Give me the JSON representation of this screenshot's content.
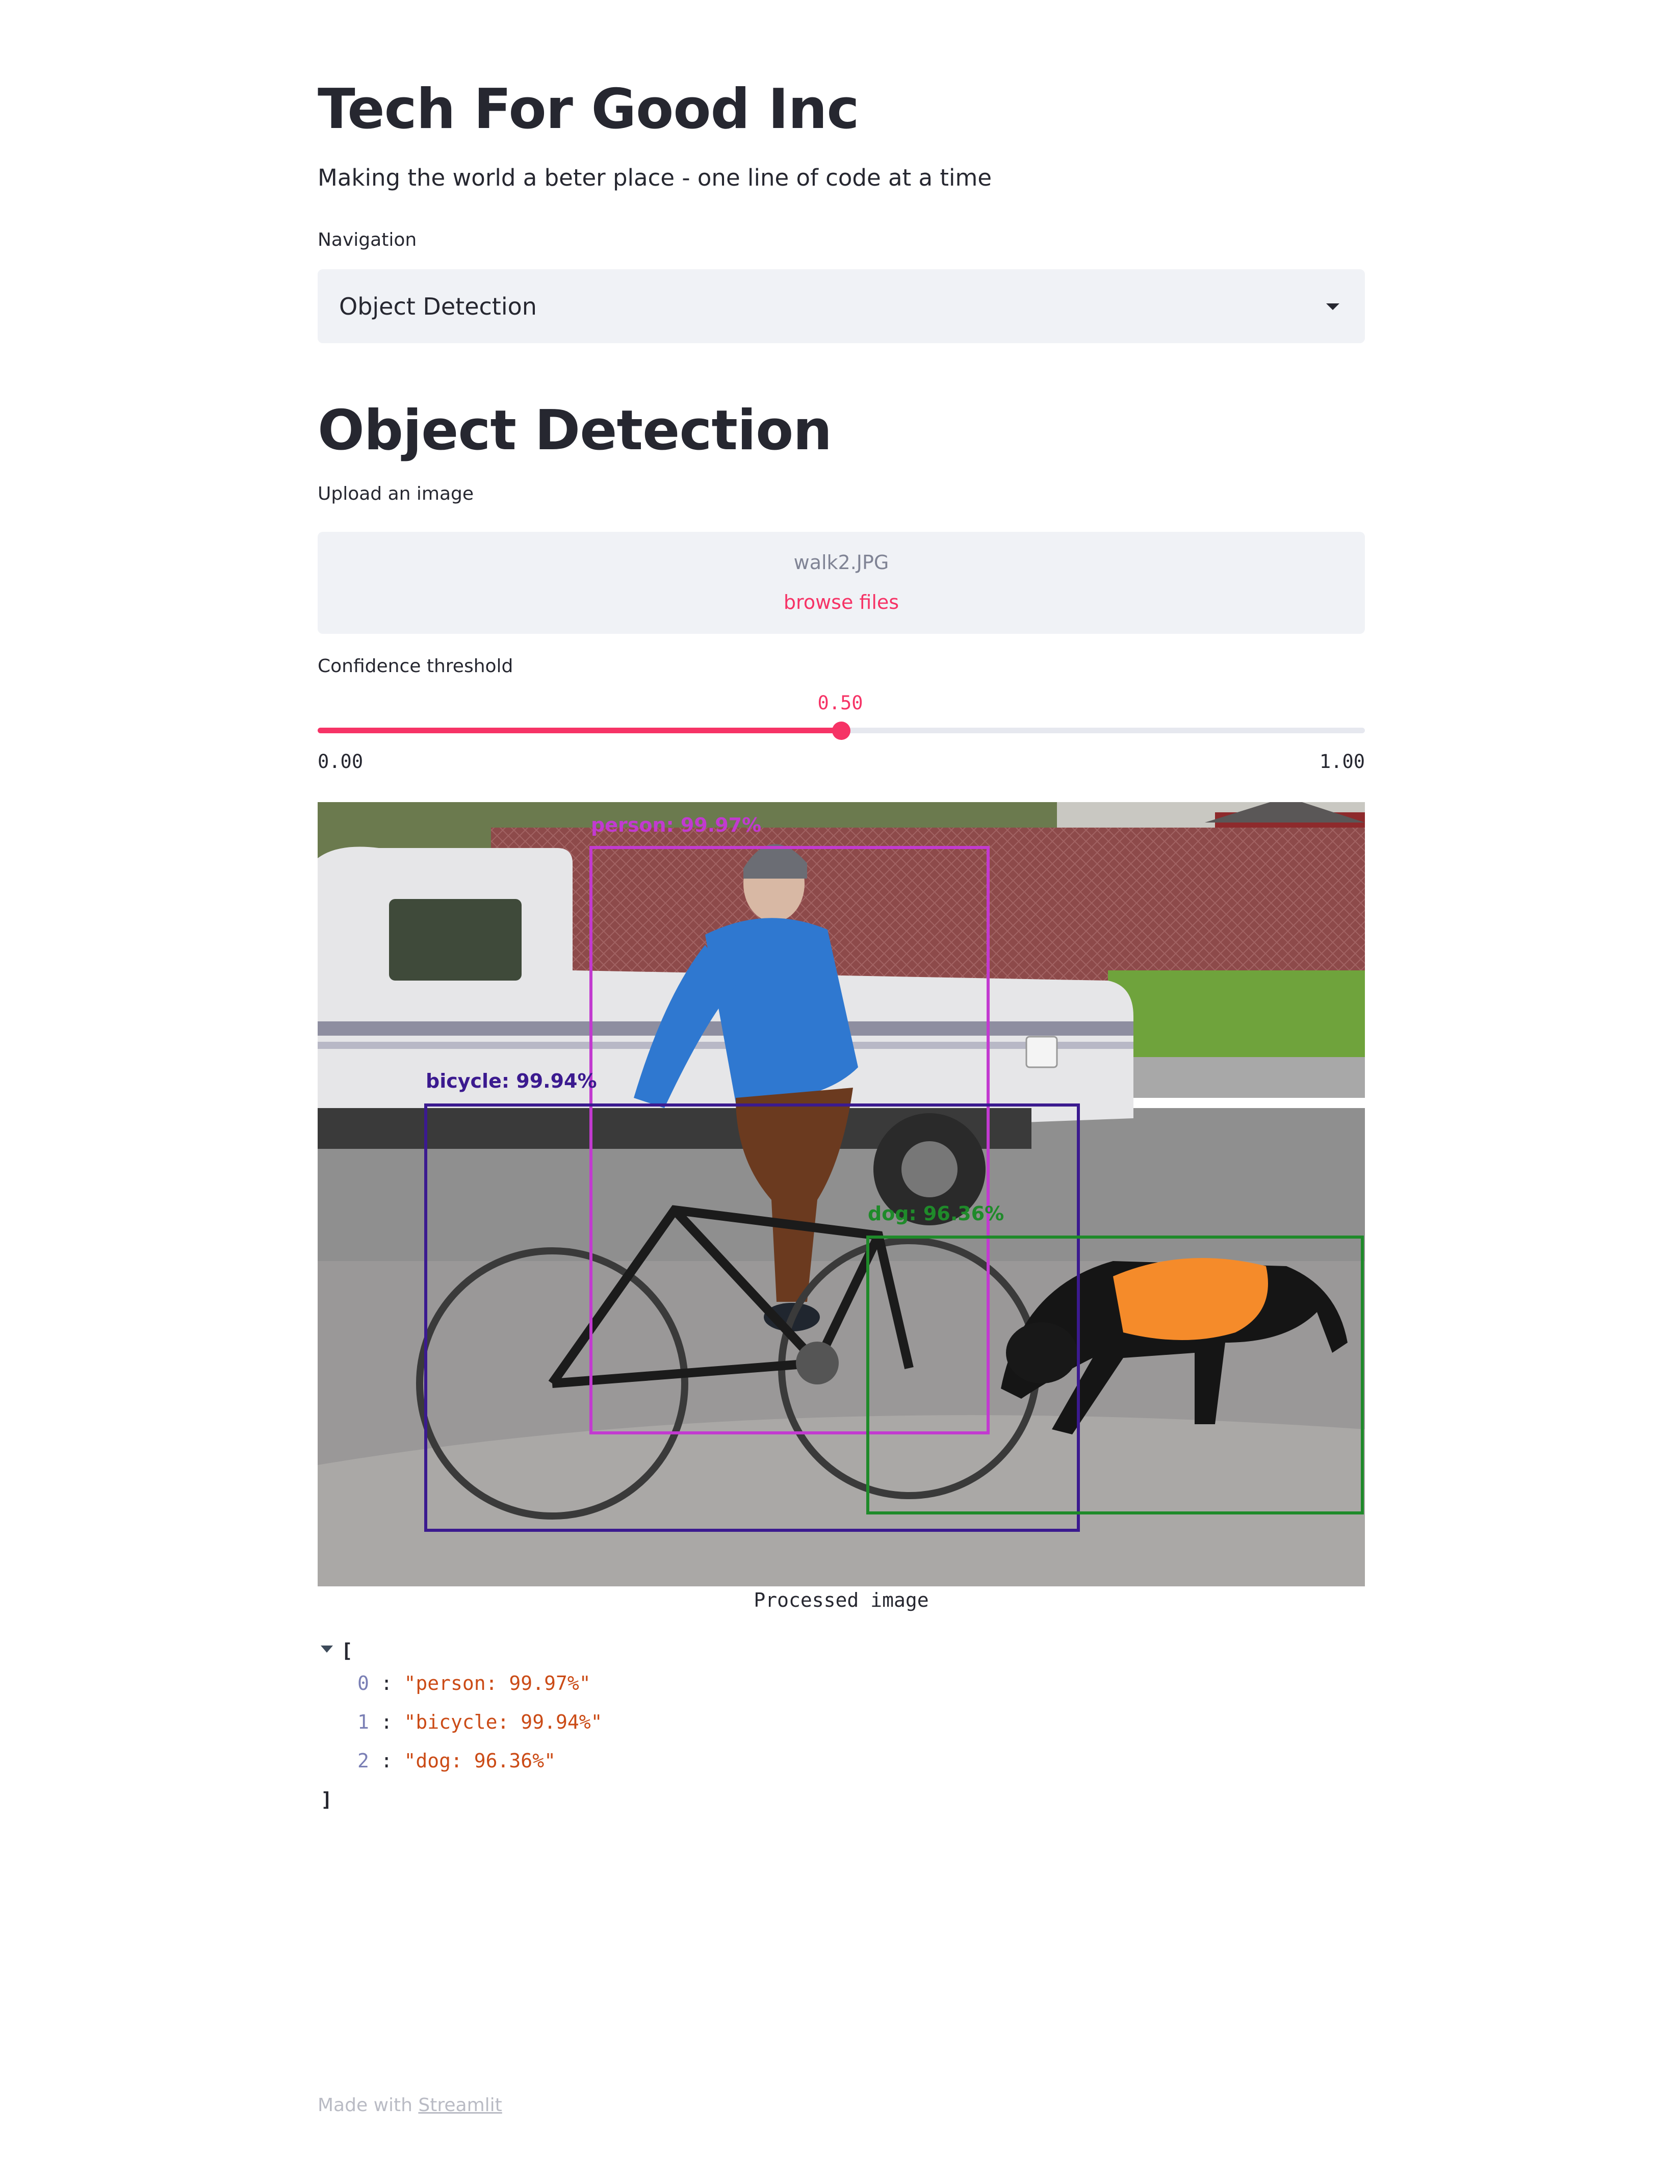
{
  "app": {
    "title": "Tech For Good Inc",
    "tagline": "Making the world a beter place - one line of code at a time"
  },
  "navigation": {
    "label": "Navigation",
    "selected": "Object Detection"
  },
  "page": {
    "header": "Object Detection"
  },
  "uploader": {
    "label": "Upload an image",
    "file_name": "walk2.JPG",
    "browse_label": "browse files"
  },
  "slider": {
    "label": "Confidence threshold",
    "value": "0.50",
    "value_fraction": 0.5,
    "min": "0.00",
    "max": "1.00"
  },
  "image": {
    "caption": "Processed image",
    "detections": [
      {
        "label": "person: 99.97%",
        "color": "#c23ad0"
      },
      {
        "label": "bicycle: 99.94%",
        "color": "#3b1a8f"
      },
      {
        "label": "dog: 96.36%",
        "color": "#1f8a2a"
      }
    ]
  },
  "json_output": {
    "open": "[",
    "close": "]",
    "items": [
      {
        "index": "0",
        "value": "\"person: 99.97%\""
      },
      {
        "index": "1",
        "value": "\"bicycle: 99.94%\""
      },
      {
        "index": "2",
        "value": "\"dog: 96.36%\""
      }
    ]
  },
  "footer": {
    "prefix": "Made with ",
    "link": "Streamlit"
  },
  "colors": {
    "accent": "#f63366",
    "widget_bg": "#f0f2f6",
    "text": "#262730"
  }
}
